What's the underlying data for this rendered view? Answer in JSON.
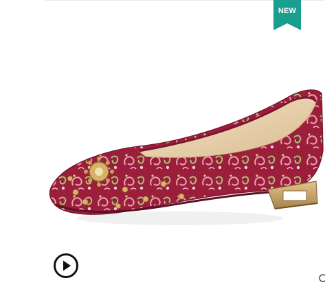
{
  "badge": {
    "label": "NEW",
    "color": "#1a9e8f"
  },
  "product": {
    "image_subject": "paisley-embroidered-pointed-toe-flat-shoe",
    "colors": {
      "upper": "#9b1f3a",
      "lining": "#efd9b8",
      "heel": "#c9a46a"
    }
  },
  "controls": {
    "video_icon": "play-circle-icon",
    "zoom_icon": "magnifier-icon"
  }
}
